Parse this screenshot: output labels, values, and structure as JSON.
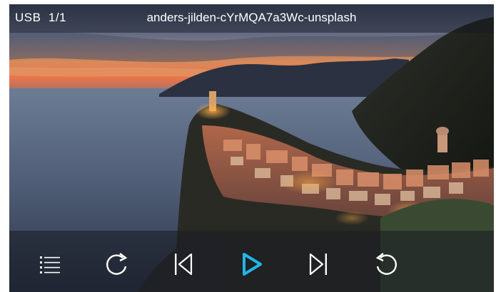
{
  "topbar": {
    "source": "USB",
    "index": "1/1",
    "filename": "anders-jilden-cYrMQA7a3Wc-unsplash"
  },
  "controls": {
    "buttons": [
      {
        "name": "playlist",
        "icon": "list-icon"
      },
      {
        "name": "rotate",
        "icon": "rotate-clockwise-icon"
      },
      {
        "name": "previous",
        "icon": "skip-previous-icon"
      },
      {
        "name": "play",
        "icon": "play-icon",
        "active_color": "#1fb7e6"
      },
      {
        "name": "next",
        "icon": "skip-next-icon"
      },
      {
        "name": "rotate-back",
        "icon": "rotate-counterclockwise-icon"
      }
    ]
  }
}
